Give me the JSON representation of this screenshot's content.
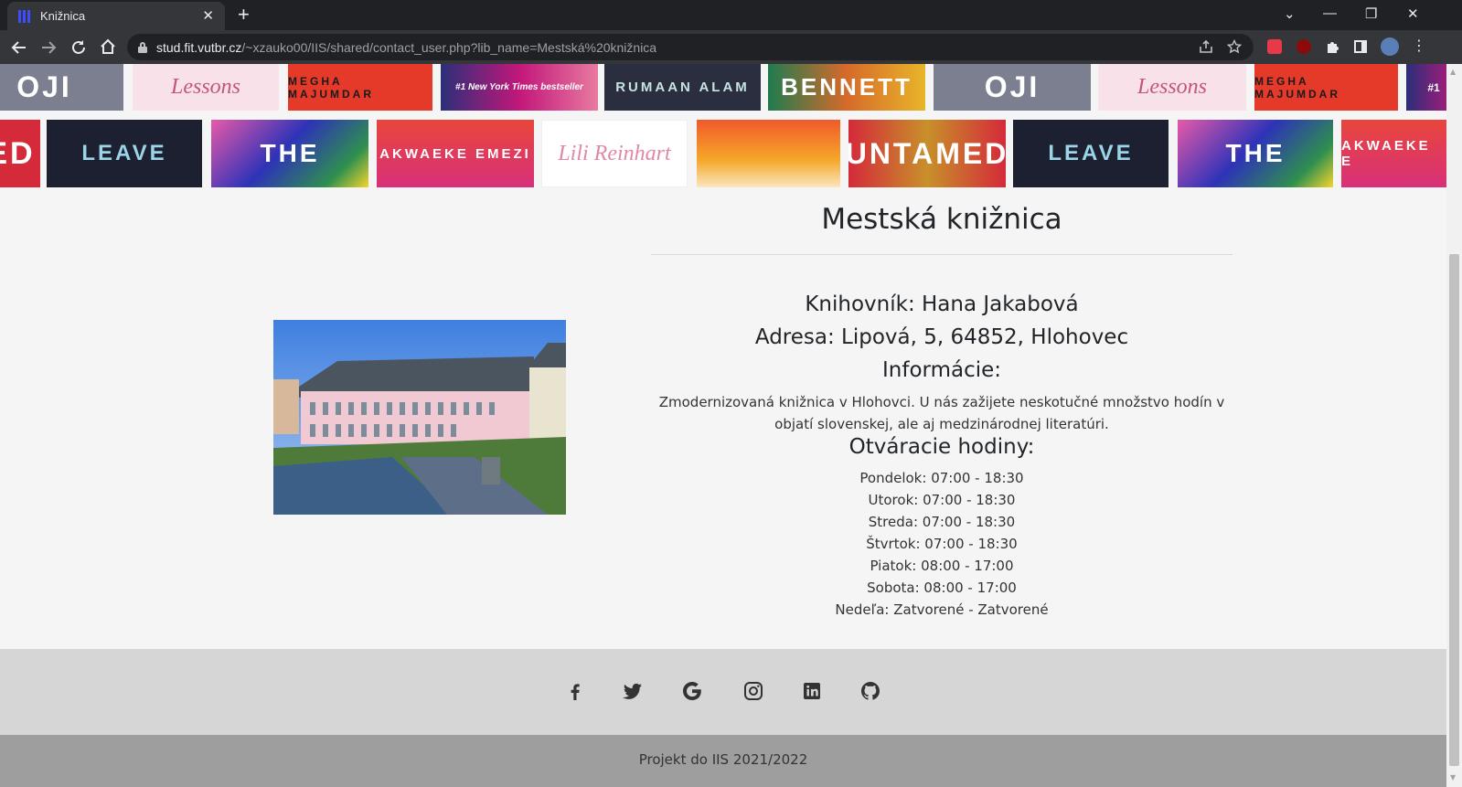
{
  "browser": {
    "tab_title": "Knižnica",
    "tab_close": "✕",
    "new_tab": "+",
    "url_host": "stud.fit.vutbr.cz",
    "url_path": "/~xzauko00/IIS/shared/contact_user.php?lib_name=Mestská%20knižnica",
    "window_controls": {
      "tab_list": "⌄",
      "minimize": "—",
      "restore": "❐",
      "close": "✕"
    }
  },
  "covers": {
    "row1": [
      {
        "text": "OJI",
        "bg": "#7c7f8f",
        "fg": "#ffffff"
      },
      {
        "text": "Lessons",
        "bg": "#f9e1ea",
        "fg": "#c2567a"
      },
      {
        "text": "MEGHA MAJUMDAR",
        "bg": "#e53a2a",
        "fg": "#1a1a1a"
      },
      {
        "text": "#1 New York Times bestseller",
        "bg": "#c2177a",
        "fg": "#ffffff"
      },
      {
        "text": "RUMAAN ALAM",
        "bg": "#2a2e3f",
        "fg": "#c7e3e2"
      },
      {
        "text": "BENNETT",
        "bg": "#1f7b4f",
        "fg": "#ffffff"
      },
      {
        "text": "OJI",
        "bg": "#7c7f8f",
        "fg": "#ffffff"
      },
      {
        "text": "Lessons",
        "bg": "#f9e1ea",
        "fg": "#c2567a"
      },
      {
        "text": "MEGHA MAJUMDAR",
        "bg": "#e53a2a",
        "fg": "#1a1a1a"
      },
      {
        "text": "#1",
        "bg": "#c2177a",
        "fg": "#ffffff"
      }
    ],
    "row2": [
      {
        "text": "ED",
        "bg": "#d42a3a",
        "fg": "#ffffff"
      },
      {
        "text": "LEAVE",
        "bg": "#1c2030",
        "fg": "#9ad4e6"
      },
      {
        "text": "THE",
        "bg": "#2e33b8",
        "fg": "#ffffff"
      },
      {
        "text": "AKWAEKE EMEZI",
        "bg": "#e8463b",
        "fg": "#ffffff"
      },
      {
        "text": "Lili Reinhart",
        "bg": "#ffffff",
        "fg": "#e089a4"
      },
      {
        "text": "",
        "bg": "#f05a2a",
        "fg": "#ffffff"
      },
      {
        "text": "UNTAMED",
        "bg": "#d42a3a",
        "fg": "#ffffff"
      },
      {
        "text": "LEAVE",
        "bg": "#1c2030",
        "fg": "#9ad4e6"
      },
      {
        "text": "THE",
        "bg": "#2e33b8",
        "fg": "#ffffff"
      },
      {
        "text": "AKWAEKE E",
        "bg": "#e8463b",
        "fg": "#ffffff"
      }
    ]
  },
  "library": {
    "name": "Mestská knižnica",
    "librarian": "Knihovník: Hana Jakabová",
    "address": "Adresa: Lipová, 5, 64852, Hlohovec",
    "info_heading": "Informácie:",
    "info_text": "Zmodernizovaná knižnica v Hlohovci. U nás zažijete neskotučné množstvo hodín v objatí slovenskej, ale aj medzinárodnej literatúri.",
    "hours_heading": "Otváracie hodiny:",
    "hours": [
      "Pondelok: 07:00 - 18:30",
      "Utorok: 07:00 - 18:30",
      "Streda: 07:00 - 18:30",
      "Štvrtok: 07:00 - 18:30",
      "Piatok: 08:00 - 17:00",
      "Sobota: 08:00 - 17:00",
      "Nedeľa: Zatvorené - Zatvorené"
    ]
  },
  "footer": {
    "social_icons": [
      "facebook-icon",
      "twitter-icon",
      "google-icon",
      "instagram-icon",
      "linkedin-icon",
      "github-icon"
    ],
    "copyright": "Projekt do IIS 2021/2022"
  }
}
